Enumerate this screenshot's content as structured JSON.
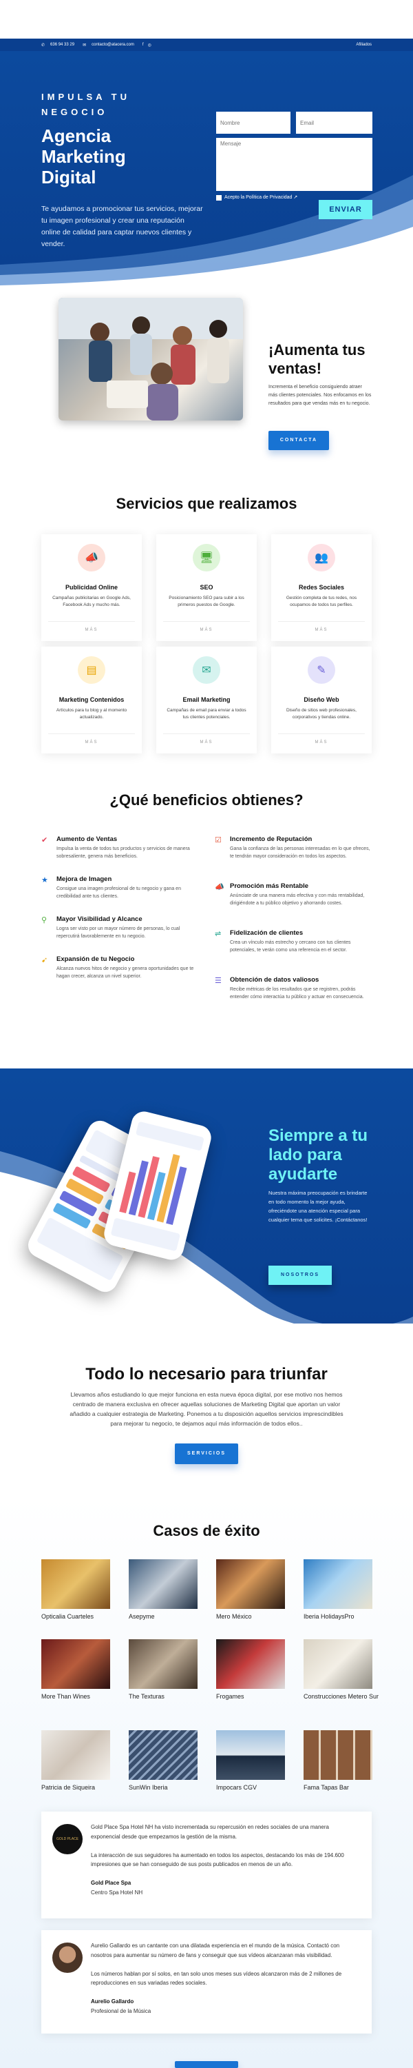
{
  "topbar": {
    "phone": "636 94 33 29",
    "email": "contacto@atacera.com",
    "affiliates": "Afiliados"
  },
  "hero": {
    "kicker": "IMPULSA TU NEGOCIO",
    "title": "Agencia Marketing Digital",
    "text": "Te ayudamos a promocionar tus servicios, mejorar tu imagen profesional y crear una reputación online de calidad para captar nuevos clientes y vender.",
    "form": {
      "name_placeholder": "Nombre",
      "email_placeholder": "Email",
      "message_placeholder": "Mensaje",
      "privacy_label": "Acepto la Política de Privacidad",
      "send_label": "ENVIAR"
    }
  },
  "sales": {
    "title": "¡Aumenta tus ventas!",
    "text": "Incrementa el beneficio consiguiendo atraer más clientes potenciales. Nos enfocamos en los resultados para que vendas más en tu negocio.",
    "button": "CONTACTA"
  },
  "services": {
    "title": "Servicios que realizamos",
    "more_label": "MÁS",
    "items": [
      {
        "title": "Publicidad Online",
        "desc": "Campañas publicitarias en Google Ads, Facebook Ads y mucho más.",
        "icon": "megaphone-icon",
        "color": "#fde0d9"
      },
      {
        "title": "SEO",
        "desc": "Posicionamiento SEO para subir a los primeros puestos de Google.",
        "icon": "seo-icon",
        "color": "#dff5d9"
      },
      {
        "title": "Redes Sociales",
        "desc": "Gestión completa de tus redes, nos ocupamos de todos tus perfiles.",
        "icon": "users-icon",
        "color": "#fde0e4"
      },
      {
        "title": "Marketing Contenidos",
        "desc": "Artículos para tu blog y al momento actualizado.",
        "icon": "content-icon",
        "color": "#fff1cf"
      },
      {
        "title": "Email Marketing",
        "desc": "Campañas de email para enviar a todos tus clientes potenciales.",
        "icon": "email-icon",
        "color": "#d6f3ef"
      },
      {
        "title": "Diseño Web",
        "desc": "Diseño de sitios web profesionales, corporativos y tiendas online.",
        "icon": "design-icon",
        "color": "#e4e2fb"
      }
    ]
  },
  "benefits": {
    "title": "¿Qué beneficios obtienes?",
    "left": [
      {
        "title": "Aumento de Ventas",
        "desc": "Impulsa la venta de todos tus productos y servicios de manera sobresaliente, genera más beneficios.",
        "icon": "check-circle-icon"
      },
      {
        "title": "Mejora de Imagen",
        "desc": "Consigue una imagen profesional de tu negocio y gana en credibilidad ante tus clientes.",
        "icon": "star-icon"
      },
      {
        "title": "Mayor Visibilidad y Alcance",
        "desc": "Logra ser visto por un mayor número de personas, lo cual repercutirá favorablemente en tu negocio.",
        "icon": "search-icon"
      },
      {
        "title": "Expansión de tu Negocio",
        "desc": "Alcanza nuevos hitos de negocio y genera oportunidades que te hagan crecer, alcanza un nivel superior.",
        "icon": "rocket-icon"
      }
    ],
    "right": [
      {
        "title": "Incremento de Reputación",
        "desc": "Gana la confianza de las personas interesadas en lo que ofreces, te tendrán mayor consideración en todos los aspectos.",
        "icon": "checkbox-icon"
      },
      {
        "title": "Promoción más Rentable",
        "desc": "Anúnciate de una manera más efectiva y con más rentabilidad, dirigiéndote a tu público objetivo y ahorrando costes.",
        "icon": "megaphone-icon"
      },
      {
        "title": "Fidelización de clientes",
        "desc": "Crea un vínculo más estrecho y cercano con tus clientes potenciales, te verán como una referencia en el sector.",
        "icon": "loyalty-icon"
      },
      {
        "title": "Obtención de datos valiosos",
        "desc": "Recibe métricas de los resultados que se registren, podrás entender cómo interactúa tu público y actuar en consecuencia.",
        "icon": "data-icon"
      }
    ]
  },
  "side": {
    "title": "Siempre a tu lado para ayudarte",
    "text": "Nuestra máxima preocupación es brindarte en todo momento la mejor ayuda, ofreciéndote una atención especial para cualquier tema que solicites. ¡Contáctanos!",
    "button": "NOSOTROS"
  },
  "need": {
    "title": "Todo lo necesario para triunfar",
    "text": "Llevamos años estudiando lo que mejor funciona en esta nueva época digital, por ese motivo nos hemos centrado de manera exclusiva en ofrecer aquellas soluciones de Marketing Digital que aportan un valor añadido a cualquier estrategia de Marketing. Ponemos a tu disposición aquellos servicios imprescindibles para mejorar tu negocio, te dejamos aquí más información de todos ellos..",
    "button": "SERVICIOS"
  },
  "cases": {
    "title": "Casos de éxito",
    "items": [
      "Opticalia Cuarteles",
      "Asepyme",
      "Mero México",
      "Iberia HolidaysPro",
      "More Than Wines",
      "The Texturas",
      "Frogames",
      "Construcciones Metero Sur",
      "Patricia de Siqueira",
      "SunWin Iberia",
      "Impocars CGV",
      "Fama Tapas Bar"
    ]
  },
  "testimonials": [
    {
      "p1": "Gold Place Spa Hotel NH ha visto incrementada su repercusión en redes sociales de una manera exponencial desde que empezamos la gestión de la misma.",
      "p2": "La interacción de sus seguidores ha aumentado en todos los aspectos, destacando los más de 194.600 impresiones que se han conseguido de sus posts publicados en menos de un año.",
      "name": "Gold Place Spa",
      "role": "Centro Spa Hotel NH",
      "logo": "GOLD PLACE"
    },
    {
      "p1": "Aurelio Gallardo es un cantante con una dilatada experiencia en el mundo de la música. Contactó con nosotros para aumentar su número de fans y conseguir que sus vídeos alcanzaran más visibilidad.",
      "p2": "Los números hablan por sí solos, en tan solo unos meses sus vídeos alcanzaron más de 2 millones de reproducciones en sus variadas redes sociales.",
      "name": "Aurelio Gallardo",
      "role": "Profesional de la Música"
    }
  ]
}
